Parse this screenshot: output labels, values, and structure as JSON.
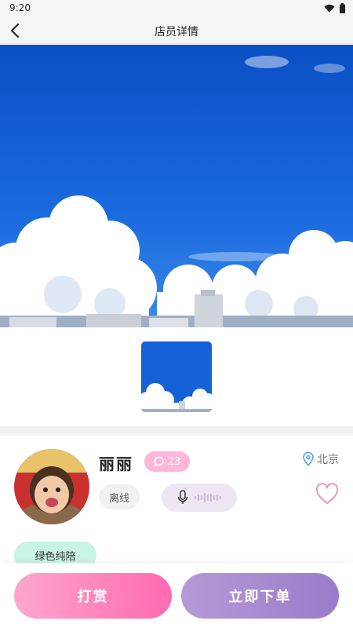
{
  "status_bar": {
    "time": "9:20"
  },
  "header": {
    "title": "店员详情"
  },
  "profile": {
    "name": "丽丽",
    "message_count": "23",
    "location": "北京",
    "status": "离线",
    "tag": "绿色纯陪"
  },
  "actions": {
    "tip_label": "打赏",
    "order_label": "立即下单"
  },
  "icons": {
    "back": "chevron-left-icon",
    "wifi": "wifi-icon",
    "battery": "battery-icon",
    "message": "chat-bubble-icon",
    "location": "location-pin-icon",
    "microphone": "microphone-icon",
    "waveform": "audio-waveform-icon",
    "favorite": "heart-outline-icon"
  },
  "colors": {
    "sky": "#1a64d6",
    "message_badge": "#ffb6d9",
    "tag_bg": "#c9f3e3",
    "tip_button": "#ff6ab0",
    "order_button": "#9a7bcb",
    "heart": "#f28bb8"
  }
}
